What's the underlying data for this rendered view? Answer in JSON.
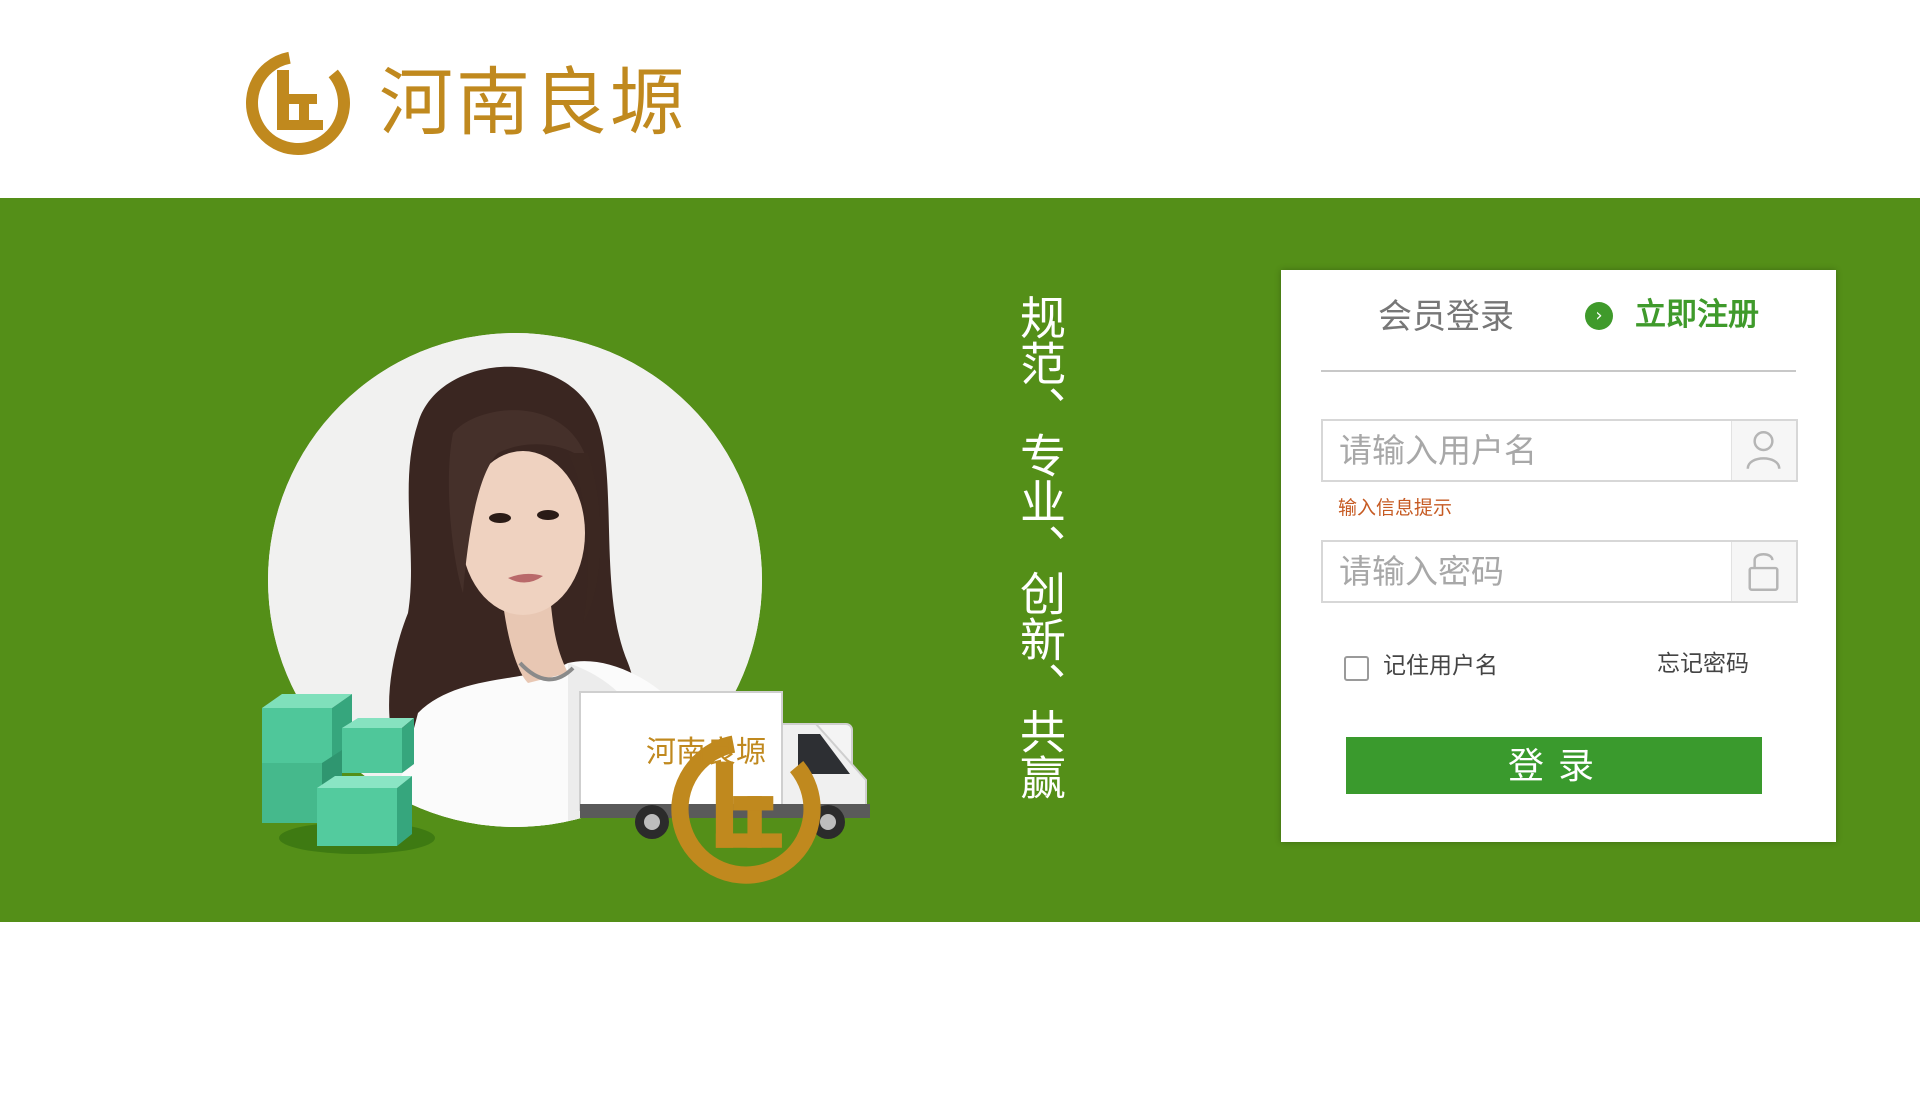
{
  "brand": {
    "name": "河南良塬",
    "logo_icon": "lg-monogram-logo-icon",
    "color": "#c0891e"
  },
  "banner": {
    "background": "#548f18",
    "slogan": "规范、专业、创新、共赢",
    "truck_label": "河南良塬"
  },
  "login": {
    "tab_login": "会员登录",
    "tab_register": "立即注册",
    "register_icon": "arrow-circle-icon",
    "username_placeholder": "请输入用户名",
    "username_value": "",
    "hint": "输入信息提示",
    "password_placeholder": "请输入密码",
    "password_value": "",
    "remember_label": "记住用户名",
    "remember_checked": false,
    "forgot_label": "忘记密码",
    "submit_label": "登录",
    "accent": "#3a9a2d"
  }
}
